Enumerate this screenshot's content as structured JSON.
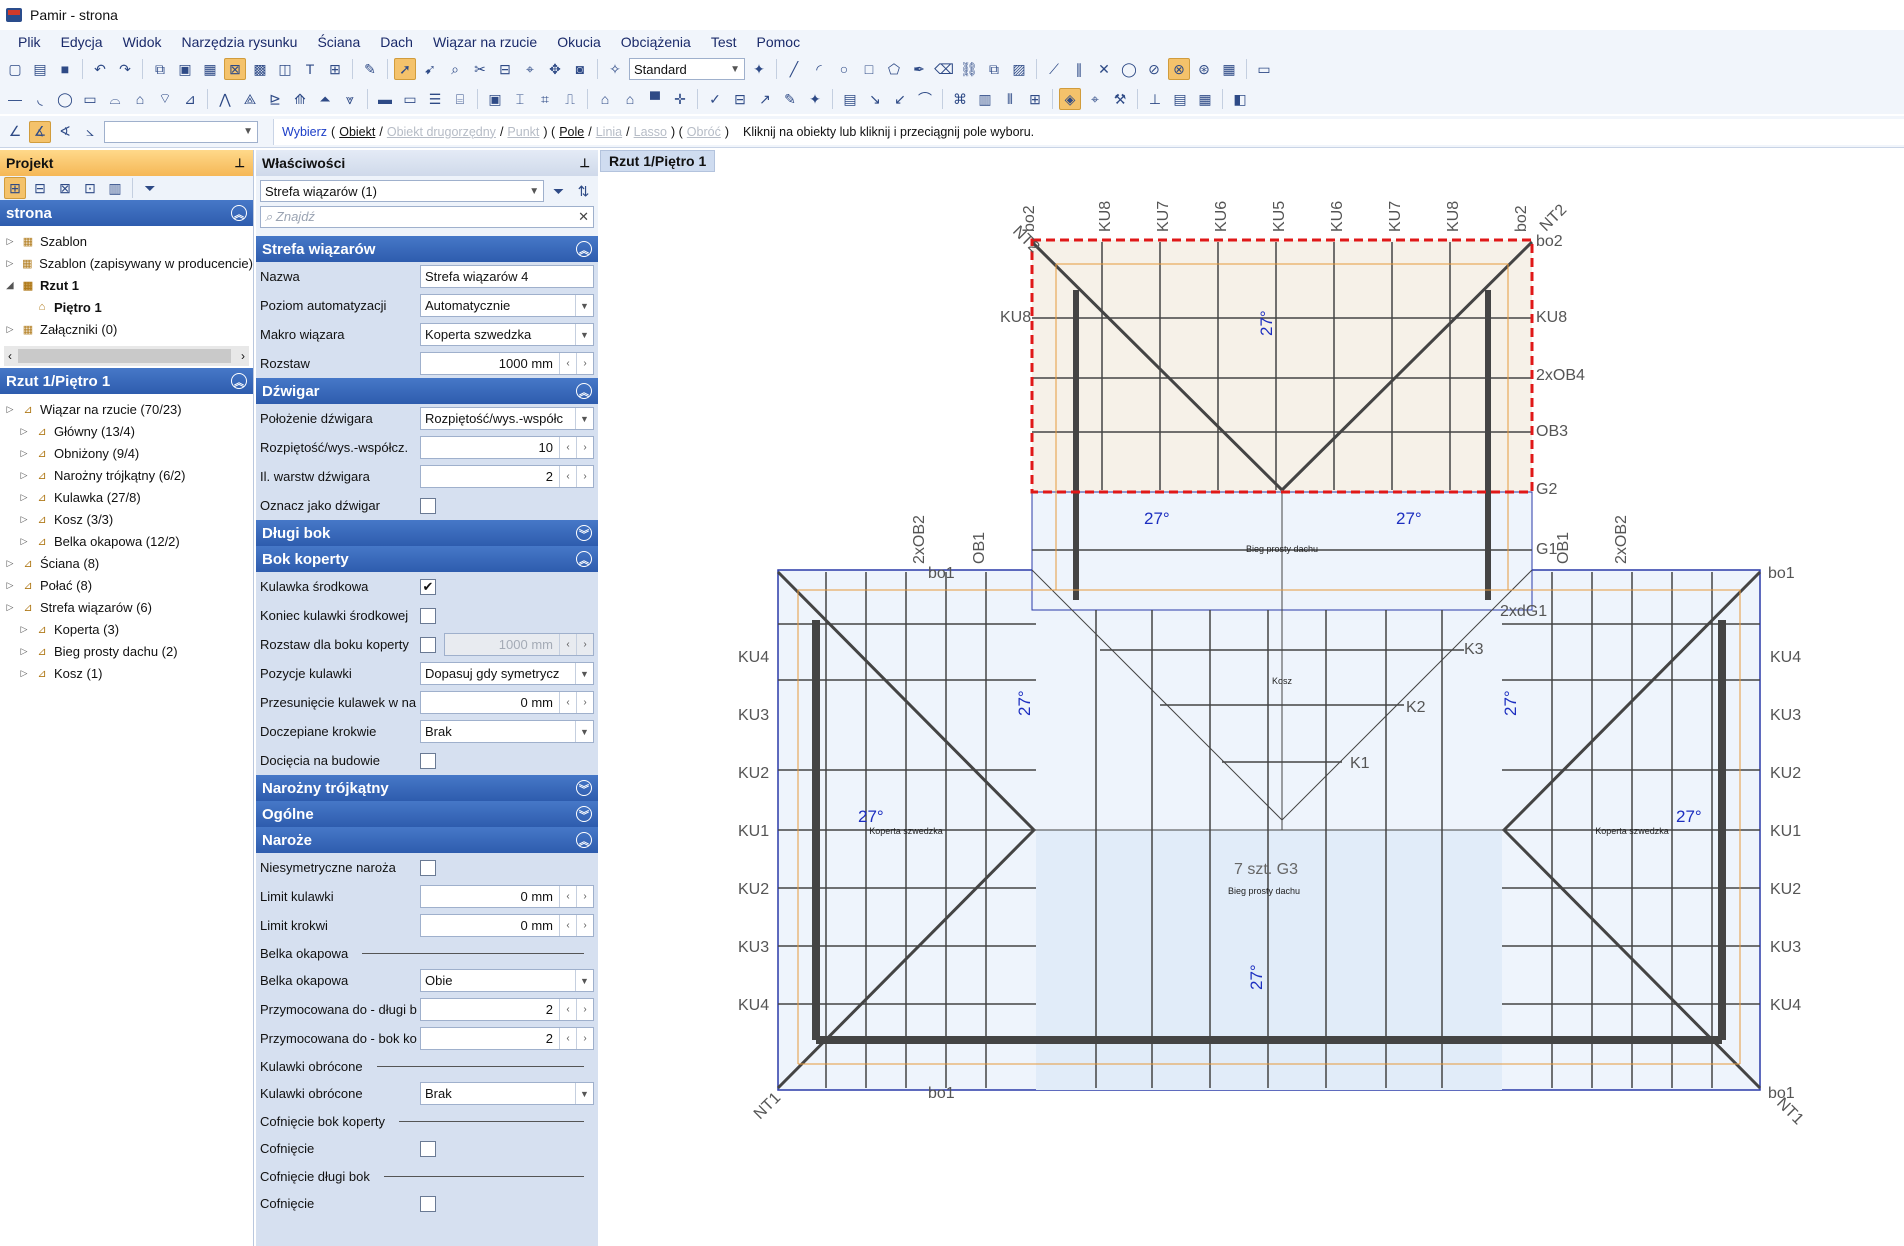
{
  "window": {
    "title": "Pamir - strona"
  },
  "menu": [
    "Plik",
    "Edycja",
    "Widok",
    "Narzędzia rysunku",
    "Ściana",
    "Dach",
    "Wiązar na rzucie",
    "Okucia",
    "Obciążenia",
    "Test",
    "Pomoc"
  ],
  "toolbar": {
    "style_combo": "Standard"
  },
  "command_line": {
    "select": "Wybierz",
    "opt_object": "Obiekt",
    "opt_secondary": "Obiekt drugorzędny",
    "opt_point": "Punkt",
    "opt_field": "Pole",
    "opt_line": "Linia",
    "opt_lasso": "Lasso",
    "opt_rotate": "Obróć",
    "hint": "Kliknij na obiekty lub kliknij i przeciągnij pole wyboru."
  },
  "project_panel": {
    "title": "Projekt",
    "section1": "strona",
    "tree1": [
      {
        "label": "Szablon",
        "bold": false,
        "indent": 0,
        "icon": "folder-icon"
      },
      {
        "label": "Szablon (zapisywany w producencie)",
        "bold": false,
        "indent": 0,
        "icon": "folder-icon"
      },
      {
        "label": "Rzut 1",
        "bold": true,
        "indent": 0,
        "icon": "folder-icon"
      },
      {
        "label": "Piętro 1",
        "bold": true,
        "indent": 1,
        "icon": "house-icon"
      },
      {
        "label": "Załączniki (0)",
        "bold": false,
        "indent": 0,
        "icon": "attachment-icon"
      }
    ],
    "section2": "Rzut 1/Piętro 1",
    "tree2": [
      {
        "label": "Wiązar na rzucie (70/23)",
        "indent": 0
      },
      {
        "label": "Główny (13/4)",
        "indent": 1
      },
      {
        "label": "Obniżony (9/4)",
        "indent": 1
      },
      {
        "label": "Narożny trójkątny (6/2)",
        "indent": 1
      },
      {
        "label": "Kulawka (27/8)",
        "indent": 1
      },
      {
        "label": "Kosz (3/3)",
        "indent": 1
      },
      {
        "label": "Belka okapowa (12/2)",
        "indent": 1
      },
      {
        "label": "Ściana (8)",
        "indent": 0
      },
      {
        "label": "Połać (8)",
        "indent": 0
      },
      {
        "label": "Strefa wiązarów (6)",
        "indent": 0
      },
      {
        "label": "Koperta (3)",
        "indent": 1
      },
      {
        "label": "Bieg prosty dachu (2)",
        "indent": 1
      },
      {
        "label": "Kosz (1)",
        "indent": 1
      }
    ]
  },
  "properties_panel": {
    "title": "Właściwości",
    "selector": "Strefa wiązarów (1)",
    "search_placeholder": "Znajdź",
    "sections": {
      "strefa": "Strefa wiązarów",
      "dzwigar": "Dźwigar",
      "dlugi_bok": "Długi bok",
      "bok_koperty": "Bok koperty",
      "narozny": "Narożny trójkątny",
      "ogolne": "Ogólne",
      "naroze": "Naroże"
    },
    "strefa_rows": {
      "nazwa_l": "Nazwa",
      "nazwa_v": "Strefa wiązarów 4",
      "poziom_l": "Poziom automatyzacji",
      "poziom_v": "Automatycznie",
      "makro_l": "Makro wiązara",
      "makro_v": "Koperta szwedzka",
      "rozstaw_l": "Rozstaw",
      "rozstaw_v": "1000 mm"
    },
    "dzwigar_rows": {
      "polozenie_l": "Położenie dźwigara",
      "polozenie_v": "Rozpiętość/wys.-współc",
      "rozp_l": "Rozpiętość/wys.-współcz.",
      "rozp_v": "10",
      "warstw_l": "Il. warstw dźwigara",
      "warstw_v": "2",
      "oznacz_l": "Oznacz jako dźwigar"
    },
    "bok_rows": {
      "kulawka_l": "Kulawka środkowa",
      "koniec_l": "Koniec kulawki środkowej",
      "rozstaw_l": "Rozstaw dla boku koperty",
      "rozstaw_v": "1000 mm",
      "pozycje_l": "Pozycje kulawki",
      "pozycje_v": "Dopasuj gdy symetrycz",
      "przes_l": "Przesunięcie kulawek w na",
      "przes_v": "0 mm",
      "docz_l": "Doczepiane krokwie",
      "docz_v": "Brak",
      "dociecia_l": "Docięcia na budowie"
    },
    "naroze_rows": {
      "niesym_l": "Niesymetryczne naroża",
      "limk_l": "Limit kulawki",
      "limk_v": "0 mm",
      "limr_l": "Limit krokwi",
      "limr_v": "0 mm",
      "belka_sub": "Belka okapowa",
      "belka_l": "Belka okapowa",
      "belka_v": "Obie",
      "przym1_l": "Przymocowana do - długi b",
      "przym1_v": "2",
      "przym2_l": "Przymocowana do - bok ko",
      "przym2_v": "2",
      "kulobr_sub": "Kulawki obrócone",
      "kulobr_l": "Kulawki obrócone",
      "kulobr_v": "Brak",
      "cofbk_sub": "Cofnięcie bok koperty",
      "cof1_l": "Cofnięcie",
      "cofdb_sub": "Cofnięcie długi bok",
      "cof2_l": "Cofnięcie"
    }
  },
  "drawing": {
    "tab": "Rzut 1/Piętro 1",
    "top_labels": [
      "NT2",
      "bo2",
      "KU8",
      "KU7",
      "KU6",
      "KU5",
      "KU6",
      "KU7",
      "KU8",
      "bo2",
      "NT2"
    ],
    "angle": "27°",
    "label_bieg": "Bieg prosty dachu",
    "label_kosz": "Kosz",
    "label_koperta": "Koperta szwedzka",
    "label_g3": "7 szt. G3",
    "labels": {
      "bo2": "bo2",
      "ku8": "KU8",
      "ob4": "2xOB4",
      "ob3": "OB3",
      "g2": "G2",
      "g1": "G1",
      "bo1": "bo1",
      "nt1": "NT1",
      "ku4": "KU4",
      "ku3": "KU3",
      "ku2": "KU2",
      "ku1": "KU1",
      "ob2": "2xOB2",
      "ob1": "OB1",
      "dg1": "2xdG1",
      "k1": "K1",
      "k2": "K2",
      "k3": "K3"
    }
  }
}
